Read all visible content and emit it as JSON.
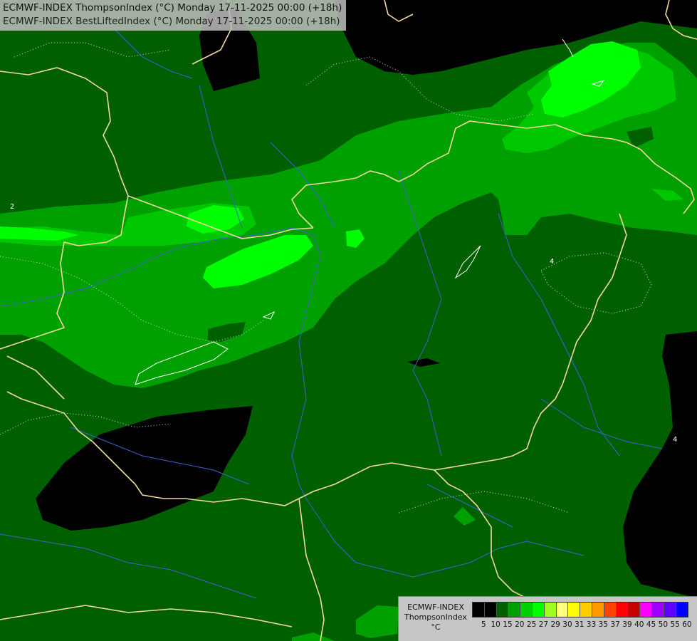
{
  "title": {
    "line1": "ECMWF-INDEX ThompsonIndex (°C) Monday 17-11-2025 00:00 (+18h)",
    "line2": "ECMWF-INDEX BestLiftedIndex (°C) Monday 17-11-2025 00:00 (+18h)"
  },
  "legend": {
    "model": "ECMWF-INDEX",
    "parameter": "ThompsonIndex",
    "unit": "°C",
    "ticks": [
      "5",
      "10",
      "15",
      "20",
      "25",
      "27",
      "29",
      "30",
      "31",
      "33",
      "35",
      "37",
      "39",
      "40",
      "45",
      "50",
      "55",
      "60"
    ],
    "colors": [
      "#000000",
      "#000000",
      "#000000",
      "#000000",
      "#006000",
      "#00a000",
      "#00d000",
      "#00ff00",
      "#a0ff20",
      "#ffff80",
      "#ffff00",
      "#ffcc00",
      "#ff9900",
      "#ff4400",
      "#ff0000",
      "#c80000",
      "#ff00ff",
      "#a000ff",
      "#6000ff",
      "#0000ff"
    ]
  },
  "map": {
    "colors": {
      "dark_green": "#006000",
      "mid_green": "#00a000",
      "bright_green": "#00c800",
      "light_green": "#00ff00",
      "black": "#000000",
      "border": "#f0d8a0",
      "river": "#4060d0"
    },
    "contour_labels": [
      "2",
      "4",
      "4"
    ]
  }
}
